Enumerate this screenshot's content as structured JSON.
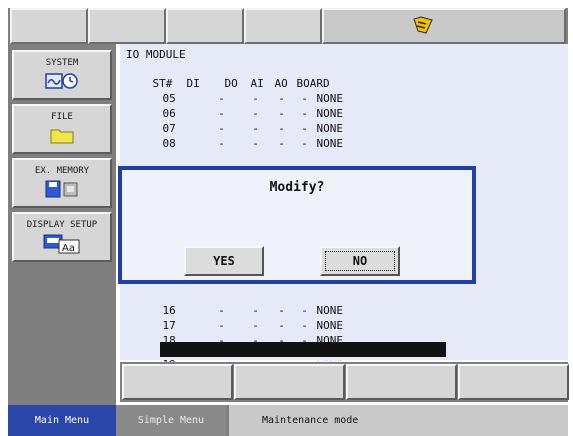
{
  "status_bar": {
    "icon": "flag-status-icon",
    "accent": "#f2c200"
  },
  "side_menu": [
    {
      "label": "SYSTEM",
      "icon": "system-clock-icon"
    },
    {
      "label": "FILE",
      "icon": "folder-icon"
    },
    {
      "label": "EX. MEMORY",
      "icon": "memory-device-icon"
    },
    {
      "label": "DISPLAY SETUP",
      "icon": "display-setup-icon"
    }
  ],
  "io_module": {
    "title": "IO MODULE",
    "headers": {
      "st": "ST#",
      "di": "DI",
      "do": "DO",
      "ai": "AI",
      "ao": "AO",
      "board": "BOARD"
    },
    "rows_top": [
      {
        "st": "05",
        "di": "-",
        "do": "-",
        "ai": "-",
        "ao": "-",
        "board": "NONE"
      },
      {
        "st": "06",
        "di": "-",
        "do": "-",
        "ai": "-",
        "ao": "-",
        "board": "NONE"
      },
      {
        "st": "07",
        "di": "-",
        "do": "-",
        "ai": "-",
        "ao": "-",
        "board": "NONE"
      },
      {
        "st": "08",
        "di": "-",
        "do": "-",
        "ai": "-",
        "ao": "-",
        "board": "NONE"
      }
    ],
    "rows_bottom": [
      {
        "st": "16",
        "di": "-",
        "do": "-",
        "ai": "-",
        "ao": "-",
        "board": "NONE"
      },
      {
        "st": "17",
        "di": "-",
        "do": "-",
        "ai": "-",
        "ao": "-",
        "board": "NONE"
      },
      {
        "st": "18",
        "di": "-",
        "do": "-",
        "ai": "-",
        "ao": "-",
        "board": "NONE"
      },
      {
        "st": "19",
        "di": "-",
        "do": "-",
        "ai": "-",
        "ao": "-",
        "board": "NONE",
        "selected": true
      }
    ]
  },
  "dialog": {
    "message": "Modify?",
    "yes_label": "YES",
    "no_label": "NO",
    "border_color": "#1f3fa6"
  },
  "bottom_bar": {
    "main_menu": "Main Menu",
    "simple_menu": "Simple Menu",
    "mode": "Maintenance mode",
    "main_menu_color": "#2a46a8"
  }
}
